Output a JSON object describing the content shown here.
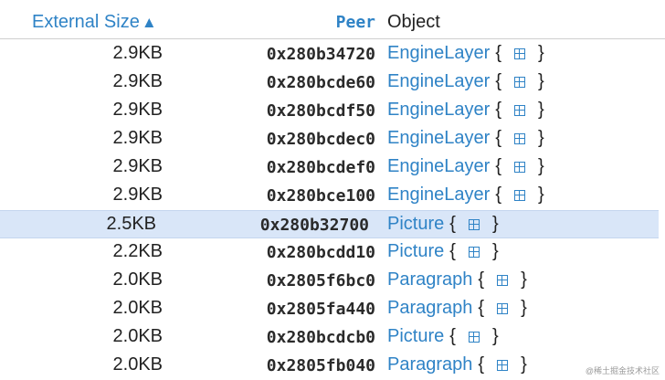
{
  "header": {
    "size_label": "External Size",
    "sort_arrow": "▲",
    "peer_label": "Peer",
    "object_label": "Object"
  },
  "rows": [
    {
      "size": "2.9KB",
      "peer": "0x280b34720",
      "type": "EngineLayer",
      "open": "{",
      "close": "}"
    },
    {
      "size": "2.9KB",
      "peer": "0x280bcde60",
      "type": "EngineLayer",
      "open": "{",
      "close": "}"
    },
    {
      "size": "2.9KB",
      "peer": "0x280bcdf50",
      "type": "EngineLayer",
      "open": "{",
      "close": "}"
    },
    {
      "size": "2.9KB",
      "peer": "0x280bcdec0",
      "type": "EngineLayer",
      "open": "{",
      "close": "}"
    },
    {
      "size": "2.9KB",
      "peer": "0x280bcdef0",
      "type": "EngineLayer",
      "open": "{",
      "close": "}"
    },
    {
      "size": "2.9KB",
      "peer": "0x280bce100",
      "type": "EngineLayer",
      "open": "{",
      "close": "}"
    },
    {
      "size": "2.5KB",
      "peer": "0x280b32700",
      "type": "Picture",
      "open": "{",
      "close": "}",
      "selected": true
    },
    {
      "size": "2.2KB",
      "peer": "0x280bcdd10",
      "type": "Picture",
      "open": "{",
      "close": "}"
    },
    {
      "size": "2.0KB",
      "peer": "0x2805f6bc0",
      "type": "Paragraph",
      "open": "{",
      "close": "}"
    },
    {
      "size": "2.0KB",
      "peer": "0x2805fa440",
      "type": "Paragraph",
      "open": "{",
      "close": "}"
    },
    {
      "size": "2.0KB",
      "peer": "0x280bcdcb0",
      "type": "Picture",
      "open": "{",
      "close": "}"
    },
    {
      "size": "2.0KB",
      "peer": "0x2805fb040",
      "type": "Paragraph",
      "open": "{",
      "close": "}"
    }
  ],
  "watermark": "@稀土掘金技术社区",
  "colors": {
    "accent": "#2f83c6",
    "selected_row": "#d9e6f8"
  },
  "icons": {
    "expand": "expand-square-icon"
  }
}
